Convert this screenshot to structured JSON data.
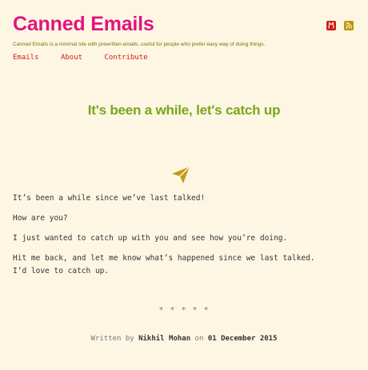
{
  "site": {
    "title": "Canned Emails",
    "tagline": "Canned Emails is a minimal site with prewritten emails, useful for people who prefer easy way of doing things."
  },
  "nav": {
    "items": [
      "Emails",
      "About",
      "Contribute"
    ]
  },
  "icons": {
    "github": "github-icon",
    "rss": "rss-icon",
    "paper_plane": "paper-plane-icon"
  },
  "colors": {
    "background": "#fdf6e3",
    "title": "#e0157f",
    "post_title": "#7aa61a",
    "nav_link": "#d01b1b",
    "icons": "#d01b1b",
    "rss": "#c0950a",
    "plane": "#c29a1a"
  },
  "post": {
    "title": "It's been a while, let's catch up",
    "paragraphs": [
      "It’s been a while since we’ve last talked!",
      "How are you?",
      "I just wanted to catch up with you and see how you’re doing.",
      "Hit me back, and let me know what’s happened since we last talked. I’d love to catch up."
    ],
    "separator": "* * * * *",
    "written_by_label": "Written by",
    "author": "Nikhil Mohan",
    "on_label": "on",
    "date": "01 December 2015"
  }
}
